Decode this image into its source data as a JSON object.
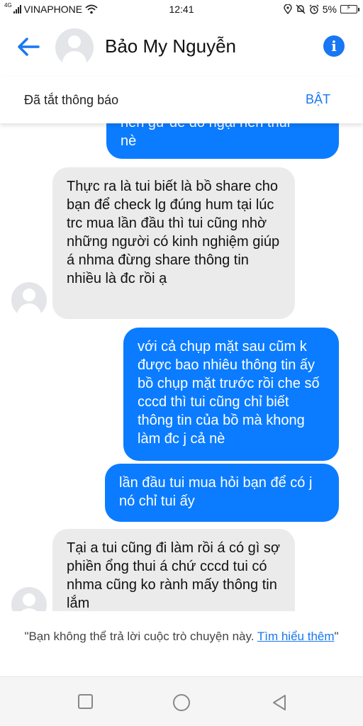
{
  "status_bar": {
    "network_type": "4G",
    "carrier": "VINAPHONE",
    "time": "12:41",
    "battery": "5%"
  },
  "header": {
    "contact_name": "Bảo My Nguyễn",
    "back_icon": "arrow-left-icon",
    "info_icon": "info-icon",
    "info_glyph": "i"
  },
  "muted_bar": {
    "text": "Đã tắt thông báo",
    "action": "BẬT"
  },
  "messages": [
    {
      "direction": "out",
      "text": "nèn gừ dể do ngại nền thui\nnè",
      "partially_visible": true
    },
    {
      "direction": "in",
      "text": "Thực ra là tui biết là bồ share cho bạn để check lg đúng hum tại lúc trc mua lần đầu thì tui cũng nhờ những người có kinh nghiệm giúp á nhma đừng share thông tin nhiều là đc rồi ạ"
    },
    {
      "direction": "out",
      "text": "với cả chụp mặt sau cũm k được bao nhiêu thông tin ấy bồ chụp mặt trước rồi che số cccd thì tui cũng chỉ biết thông tin của bồ mà khong làm đc j cả nè"
    },
    {
      "direction": "out",
      "text": "lần đầu tui mua hỏi bạn để có j nó chỉ tui ấy"
    },
    {
      "direction": "in",
      "text": "Tại a tui cũng đi làm rồi á có gì sợ phiền ổng thui á chứ cccd tui có nhma cũng ko rành mấy thông tin lắm",
      "partially_visible": true
    }
  ],
  "footer": {
    "notice_prefix": "\"Bạn không thể trả lời cuộc trò chuyện này. ",
    "link_text": "Tìm hiểu thêm",
    "notice_suffix": "\""
  },
  "colors": {
    "accent": "#1877f2",
    "outgoing_bubble": "#0b7cff",
    "incoming_bubble": "#ebebeb"
  }
}
